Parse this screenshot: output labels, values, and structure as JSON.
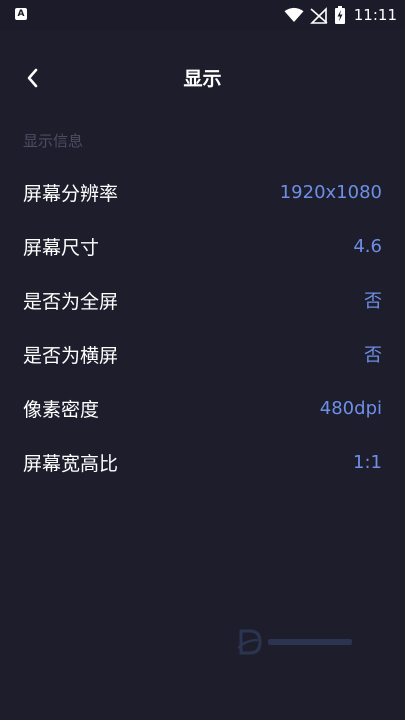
{
  "status_bar": {
    "left_icon_letter": "A",
    "time": "11:11"
  },
  "header": {
    "back_label": "❮",
    "title": "显示"
  },
  "section": {
    "title": "显示信息"
  },
  "rows": [
    {
      "label": "屏幕分辨率",
      "value": "1920x1080"
    },
    {
      "label": "屏幕尺寸",
      "value": "4.6"
    },
    {
      "label": "是否为全屏",
      "value": "否"
    },
    {
      "label": "是否为横屏",
      "value": "否"
    },
    {
      "label": "像素密度",
      "value": "480dpi"
    },
    {
      "label": "屏幕宽高比",
      "value": "1:1"
    }
  ],
  "colors": {
    "background": "#1e1d2c",
    "value_accent": "#6d8fe6",
    "section_header": "#4e4c62"
  }
}
